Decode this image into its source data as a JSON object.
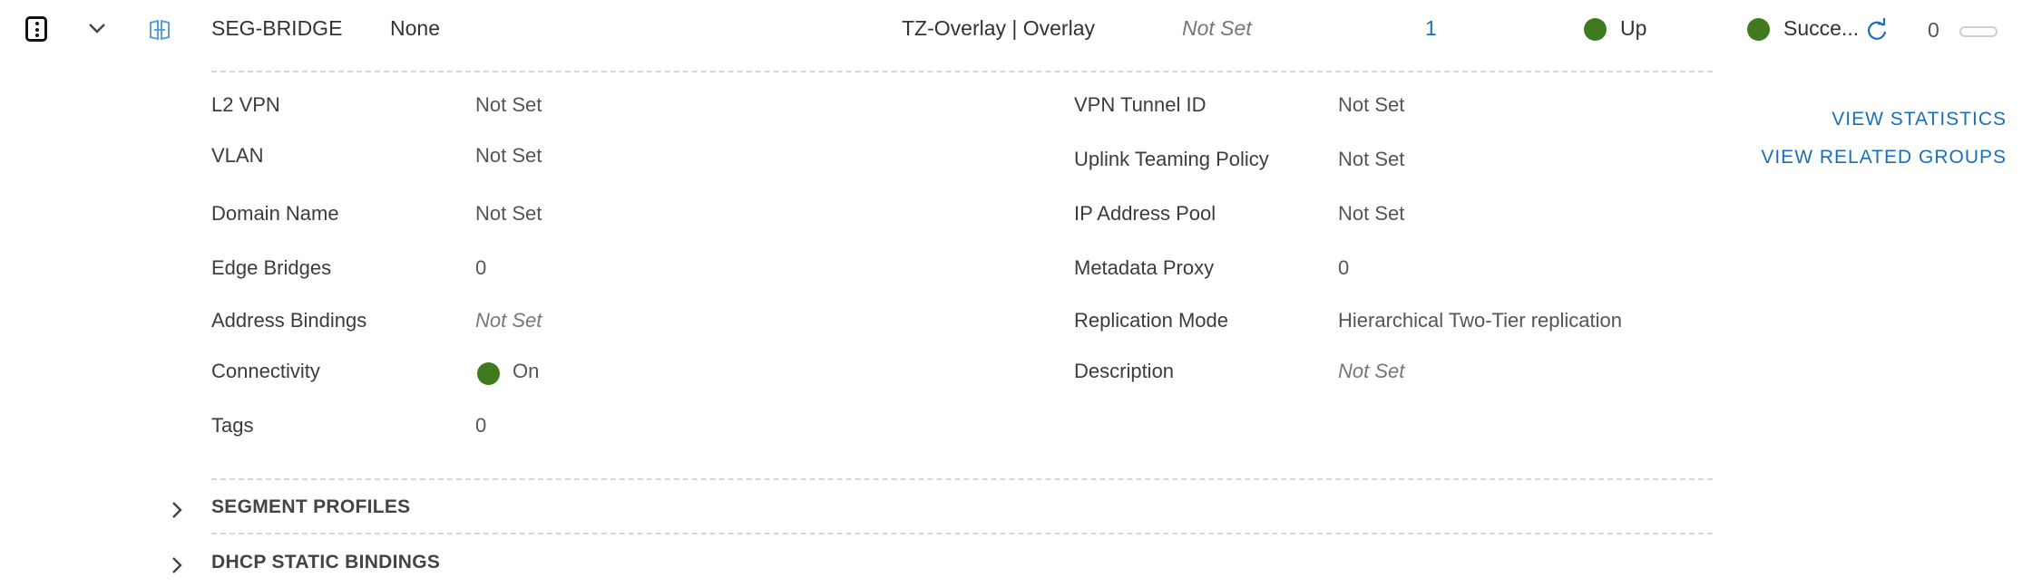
{
  "row": {
    "name": "SEG-BRIDGE",
    "gateway": "None",
    "transport_zone": "TZ-Overlay | Overlay",
    "subnets": "Not Set",
    "ports": "1",
    "admin_status": "Up",
    "realized_status": "Succe...",
    "alarms": "0",
    "status_color": "#3f7a1f",
    "link_color": "#1a6fb8"
  },
  "details": {
    "left": [
      {
        "label": "L2 VPN",
        "value": "Not Set"
      },
      {
        "label": "VLAN",
        "value": "Not Set"
      },
      {
        "label": "Domain Name",
        "value": "Not Set"
      },
      {
        "label": "Edge Bridges",
        "value": "0"
      },
      {
        "label": "Address Bindings",
        "value": "Not Set"
      },
      {
        "label": "Connectivity",
        "value": "On"
      },
      {
        "label": "Tags",
        "value": "0"
      }
    ],
    "right": [
      {
        "label": "VPN Tunnel ID",
        "value": "Not Set"
      },
      {
        "label": "Uplink Teaming Policy",
        "value": "Not Set"
      },
      {
        "label": "IP Address Pool",
        "value": "Not Set"
      },
      {
        "label": "Metadata Proxy",
        "value": "0"
      },
      {
        "label": "Replication Mode",
        "value": "Hierarchical Two-Tier replication"
      },
      {
        "label": "Description",
        "value": "Not Set"
      }
    ]
  },
  "actions": {
    "view_statistics": "VIEW STATISTICS",
    "view_related_groups": "VIEW RELATED GROUPS"
  },
  "sections": {
    "segment_profiles": "SEGMENT PROFILES",
    "dhcp_static_bindings": "DHCP STATIC BINDINGS"
  },
  "icons": {
    "menu": "kebab-menu-icon",
    "expand": "chevron-down-icon",
    "segment": "segment-icon",
    "refresh": "refresh-icon",
    "collapsed": "chevron-right-icon"
  }
}
